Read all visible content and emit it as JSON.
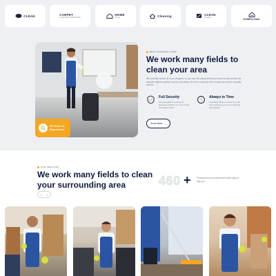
{
  "partner_logos": [
    {
      "name": "logo-1",
      "text": "CLEAN",
      "sub": ""
    },
    {
      "name": "logo-2",
      "text": "CARPET",
      "sub": "CLEANING SERVICES"
    },
    {
      "name": "logo-3",
      "text": "HOME",
      "sub": "Clean"
    },
    {
      "name": "logo-4",
      "text": "Cleaning",
      "sub": ""
    },
    {
      "name": "logo-5",
      "text": "CLEAN",
      "sub": "GLASS"
    },
    {
      "name": "logo-6",
      "text": "HOMECLEAN",
      "sub": ""
    }
  ],
  "about": {
    "tag": "BEST CLEANING CORP",
    "title": "We work many fields to clean your area",
    "description": "We carefully screen all of our cleaners, so you can rest assured that your home would receive the absolute highest quality of service providing. We are a company with a long track record of quality service.",
    "experience_badge": "15 Years of Experience",
    "features": [
      {
        "title": "Full Security",
        "text": "We specialize in a range of cleaning solutions for every small and large project."
      },
      {
        "title": "Always in Time",
        "text": "Providing efficient service you can trust, keeping your home cleaning and special."
      }
    ],
    "button_label": "Know More",
    "button_arrow": "→"
  },
  "services": {
    "tag": "OUR SERVICES",
    "title": "We work many fields to clean your surrounding area",
    "counter": "460",
    "counter_plus": "+",
    "counter_text": "Professional and experienced staff ready to help you.",
    "nav_prev": "‹",
    "nav_next": "›"
  },
  "colors": {
    "accent": "#f5a623",
    "navy": "#0e1b3d",
    "band": "#eef0f3",
    "uniform": "#2b55a3"
  },
  "icons": [
    "logo-icon",
    "clock-icon",
    "shield-icon",
    "arrow-right-icon",
    "chevron-left-icon",
    "chevron-right-icon"
  ]
}
